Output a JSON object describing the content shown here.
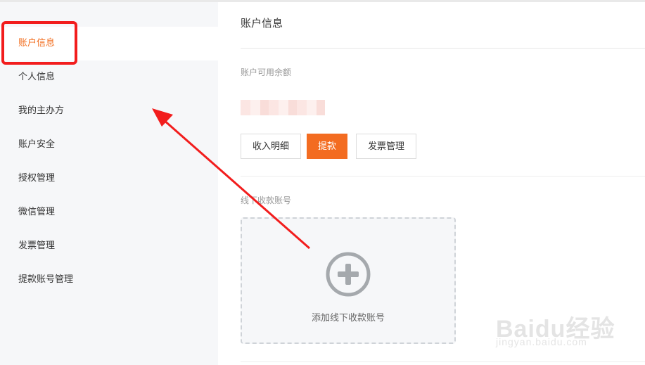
{
  "sidebar": {
    "items": [
      {
        "label": "账户信息",
        "active": true
      },
      {
        "label": "个人信息",
        "active": false
      },
      {
        "label": "我的主办方",
        "active": false
      },
      {
        "label": "账户安全",
        "active": false
      },
      {
        "label": "授权管理",
        "active": false
      },
      {
        "label": "微信管理",
        "active": false
      },
      {
        "label": "发票管理",
        "active": false
      },
      {
        "label": "提款账号管理",
        "active": false
      }
    ]
  },
  "main": {
    "title": "账户信息",
    "balance_label": "账户可用余额",
    "buttons": {
      "income_detail": "收入明细",
      "withdraw": "提款",
      "invoice_manage": "发票管理"
    },
    "offline_label": "线下收款账号",
    "add_account": "添加线下收款账号"
  },
  "watermark": {
    "logo": "Baidu经验",
    "url": "jingyan.baidu.com"
  },
  "colors": {
    "accent": "#f36c21",
    "highlight": "#f21d1d",
    "sidebar_bg": "#f6f7f9"
  }
}
